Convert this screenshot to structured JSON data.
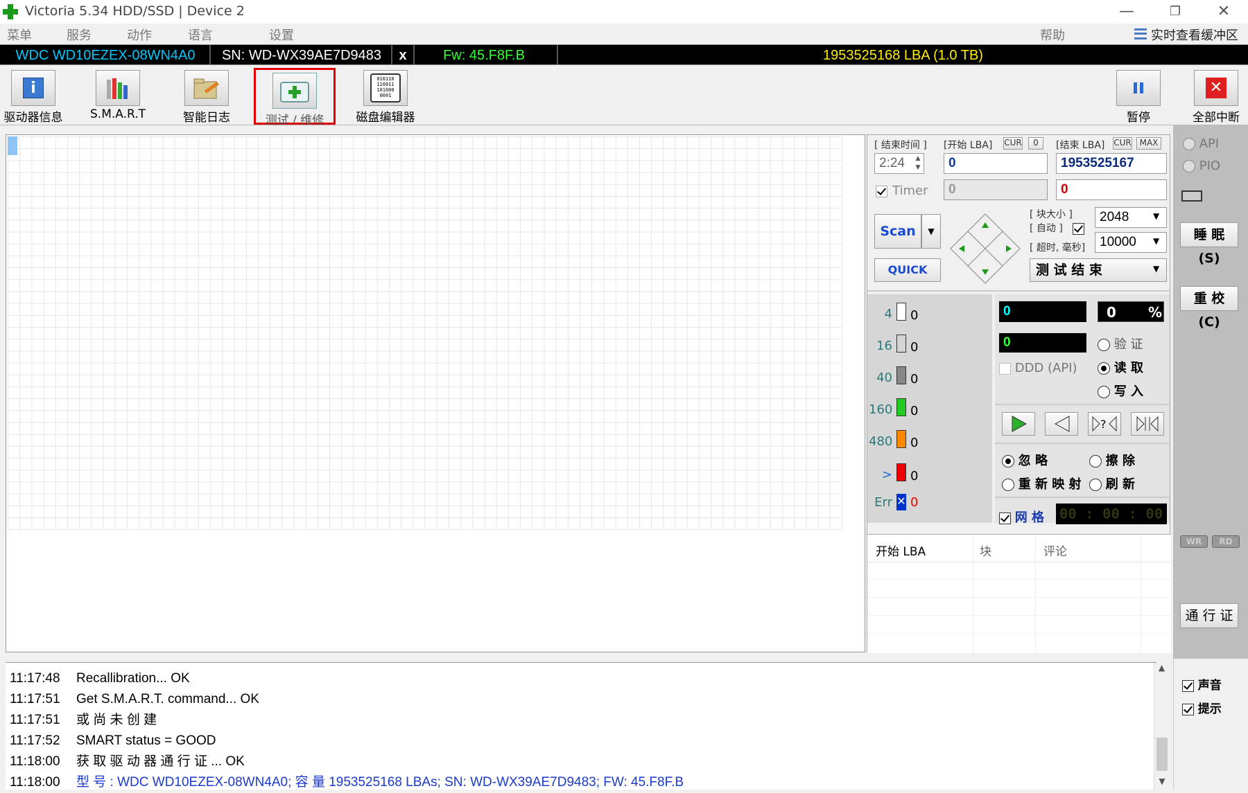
{
  "window": {
    "title": "Victoria 5.34 HDD/SSD | Device 2",
    "minimize": "—",
    "restore": "❐",
    "close": "✕"
  },
  "menu": {
    "items": [
      "菜单",
      "服务",
      "动作",
      "语言",
      "设置"
    ],
    "help": "帮助",
    "buffer": "实时查看缓冲区"
  },
  "drive": {
    "model": "WDC WD10EZEX-08WN4A0",
    "serial": "SN: WD-WX39AE7D9483",
    "close": "x",
    "firmware": "Fw: 45.F8F.B",
    "capacity": "1953525168 LBA (1.0 TB)"
  },
  "toolbar": {
    "drive_info": "驱动器信息",
    "smart": "S.M.A.R.T",
    "smart_log": "智能日志",
    "test_repair": "测试 / 维修",
    "disk_editor": "磁盘编辑器",
    "pause": "暂停",
    "abort_all": "全部中断",
    "editor_glyph": "010110\n110011\n101000\n0001"
  },
  "test": {
    "end_time_label": "[ 结束时间 ]",
    "end_time": "2:24",
    "start_lba_label": "[开始 LBA]",
    "cur": "CUR",
    "zero": "0",
    "end_lba_label": "[结束 LBA]",
    "max": "MAX",
    "start_lba": "0",
    "end_lba": "1953525167",
    "timer_label": "Timer",
    "timer_value": "0",
    "end_lba2": "0",
    "block_size_label": "[ 块大小 ]",
    "auto_label": "[ 自动 ]",
    "block_size": "2048",
    "timeout_label": "[ 超时, 毫秒]",
    "timeout": "10000",
    "scan": "Scan",
    "quick": "QUICK",
    "end_action": "测 试 结 束"
  },
  "stats": {
    "rows": [
      {
        "label": "4",
        "count": "0",
        "color": "#ffffff"
      },
      {
        "label": "16",
        "count": "0",
        "color": "#d4d4d4"
      },
      {
        "label": "40",
        "count": "0",
        "color": "#888888"
      },
      {
        "label": "160",
        "count": "0",
        "color": "#22cc22"
      },
      {
        "label": "480",
        "count": "0",
        "color": "#ff8800"
      },
      {
        "label": ">",
        "count": "0",
        "color": "#ee0000"
      },
      {
        "label": "Err",
        "count": "0",
        "color": "#0033cc"
      }
    ],
    "position": "0",
    "percent": "0",
    "percent_sign": "%",
    "speed": "0",
    "verify": "验 证",
    "read": "读 取",
    "write": "写 入",
    "ddd": "DDD (API)",
    "ignore": "忽 略",
    "erase": "擦 除",
    "remap": "重 新 映 射",
    "refresh": "刷 新",
    "grid": "网 格",
    "timer": "00 : 00 : 00"
  },
  "table": {
    "col1": "开始 LBA",
    "col2": "块",
    "col3": "评论"
  },
  "side": {
    "api": "API",
    "pio": "PIO",
    "sleep": "睡 眠 (S)",
    "recal": "重 校 (C)",
    "wr": "WR",
    "rd": "RD",
    "passport": "通 行 证",
    "sound": "声音",
    "hints": "提示"
  },
  "log": [
    {
      "time": "11:17:48",
      "text": "Recallibration... OK",
      "blue": false
    },
    {
      "time": "11:17:51",
      "text": "Get S.M.A.R.T. command... OK",
      "blue": false
    },
    {
      "time": "11:17:51",
      "text": "或 尚 未 创 建",
      "blue": false
    },
    {
      "time": "11:17:52",
      "text": "SMART status = GOOD",
      "blue": false
    },
    {
      "time": "11:18:00",
      "text": "获 取 驱 动 器 通 行 证 ... OK",
      "blue": false
    },
    {
      "time": "11:18:00",
      "text": "型 号 : WDC WD10EZEX-08WN4A0; 容 量 1953525168 LBAs; SN: WD-WX39AE7D9483; FW: 45.F8F.B",
      "blue": true
    }
  ]
}
